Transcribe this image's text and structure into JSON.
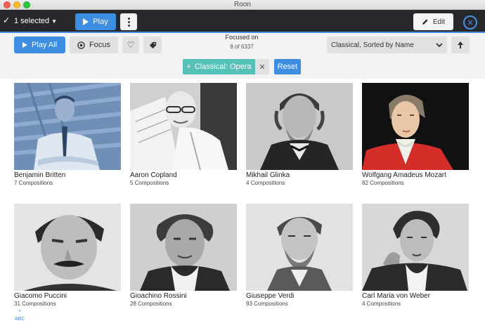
{
  "window": {
    "title": "Roon"
  },
  "selection_bar": {
    "selected_label": "1 selected",
    "play_label": "Play",
    "edit_label": "Edit"
  },
  "toolbar": {
    "play_all_label": "Play All",
    "focus_label": "Focus",
    "focused_label": "Focused on",
    "focused_count": "8 of 6337",
    "sort_label": "Classical, Sorted by Name",
    "filter_chip_label": "Classical: Opera",
    "reset_label": "Reset"
  },
  "composers": [
    {
      "name": "Benjamin Britten",
      "count": "7 Compositions"
    },
    {
      "name": "Aaron Copland",
      "count": "5 Compositions"
    },
    {
      "name": "Mikhail Glinka",
      "count": "4 Compositions"
    },
    {
      "name": "Wolfgang Amadeus Mozart",
      "count": "82 Compositions"
    },
    {
      "name": "Giacomo Puccini",
      "count": "31 Compositions"
    },
    {
      "name": "Gioachino Rossini",
      "count": "28 Compositions"
    },
    {
      "name": "Giuseppe Verdi",
      "count": "93 Compositions"
    },
    {
      "name": "Carl Maria von Weber",
      "count": "4 Compositions"
    }
  ],
  "alpha_jump_label": "ABC",
  "colors": {
    "accent": "#3d8de0",
    "chip": "#56c1b6",
    "bar": "#26282c"
  }
}
